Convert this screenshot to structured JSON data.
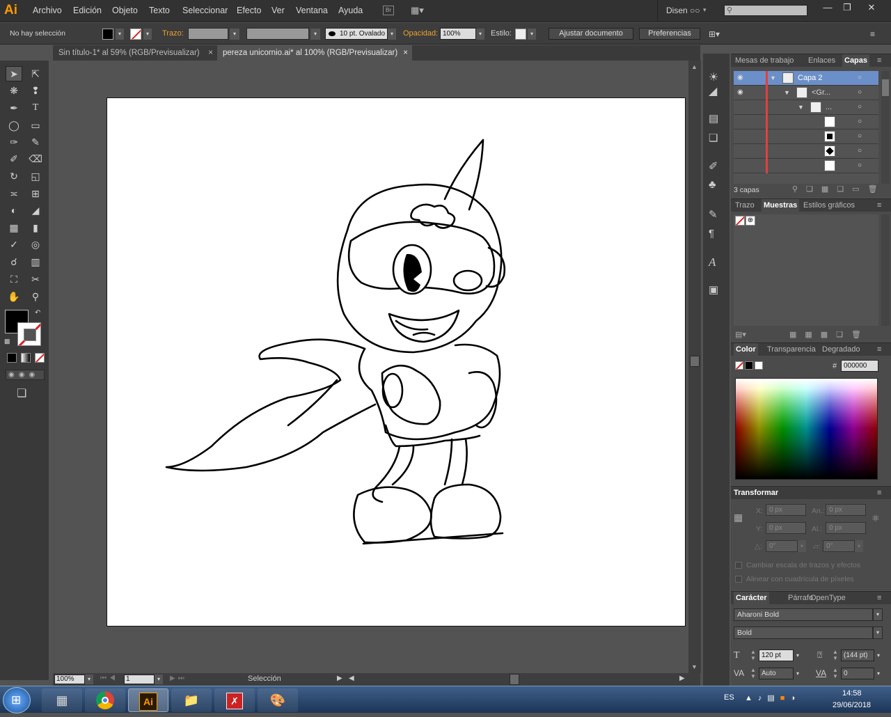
{
  "app": {
    "logo": "Ai"
  },
  "menus": [
    "Archivo",
    "Edición",
    "Objeto",
    "Texto",
    "Seleccionar",
    "Efecto",
    "Ver",
    "Ventana",
    "Ayuda"
  ],
  "menu_extra": {
    "br": "Br"
  },
  "workspace": "Disen ○○",
  "control": {
    "selection": "No hay selección",
    "stroke_label": "Trazo:",
    "brush": "10 pt. Ovalado",
    "opacity_label": "Opacidad:",
    "opacity": "100%",
    "style_label": "Estilo:",
    "adjust": "Ajustar documento",
    "prefs": "Preferencias"
  },
  "tabs": [
    {
      "label": "Sin título-1* al 59% (RGB/Previsualizar)",
      "close": "×"
    },
    {
      "label": "pereza unicornio.ai* al 100% (RGB/Previsualizar)",
      "close": "×"
    }
  ],
  "status": {
    "zoom": "100%",
    "page": "1",
    "tool": "Selección"
  },
  "layers_panel": {
    "tabs": [
      "Mesas de trabajo",
      "Enlaces",
      "Capas"
    ],
    "rows": [
      {
        "name": "Capa 2"
      },
      {
        "name": "<Gr..."
      },
      {
        "name": "..."
      },
      {
        "name": ""
      },
      {
        "name": ""
      },
      {
        "name": ""
      },
      {
        "name": ""
      },
      {
        "name": ""
      }
    ],
    "count": "3 capas"
  },
  "swatches_panel": {
    "tabs": [
      "Trazo",
      "Muestras",
      "Estilos gráficos"
    ]
  },
  "color_panel": {
    "tabs": [
      "Color",
      "Transparencia",
      "Degradado"
    ],
    "hash": "#",
    "hex": "000000"
  },
  "transform_panel": {
    "title": "Transformar",
    "x_label": "X:",
    "x": "0 px",
    "w_label": "An.:",
    "w": "0 px",
    "y_label": "Y:",
    "y": "0 px",
    "h_label": "Al.:",
    "h": "0 px",
    "rot": "0°",
    "shear": "0°",
    "opt1": "Cambiar escala de trazos y efectos",
    "opt2": "Alinear con cuadrícula de píxeles"
  },
  "character_panel": {
    "tabs": [
      "Carácter",
      "Párrafo",
      "OpenType"
    ],
    "font": "Aharoni Bold",
    "style": "Bold",
    "size": "120 pt",
    "leading": "(144 pt)",
    "kerning": "Auto",
    "tracking": "0"
  },
  "taskbar": {
    "lang": "ES",
    "time": "14:58",
    "date": "29/06/2018",
    "ai": "Ai"
  },
  "colors": {
    "ai_orange": "#ff9a00",
    "fill": "#000000"
  }
}
